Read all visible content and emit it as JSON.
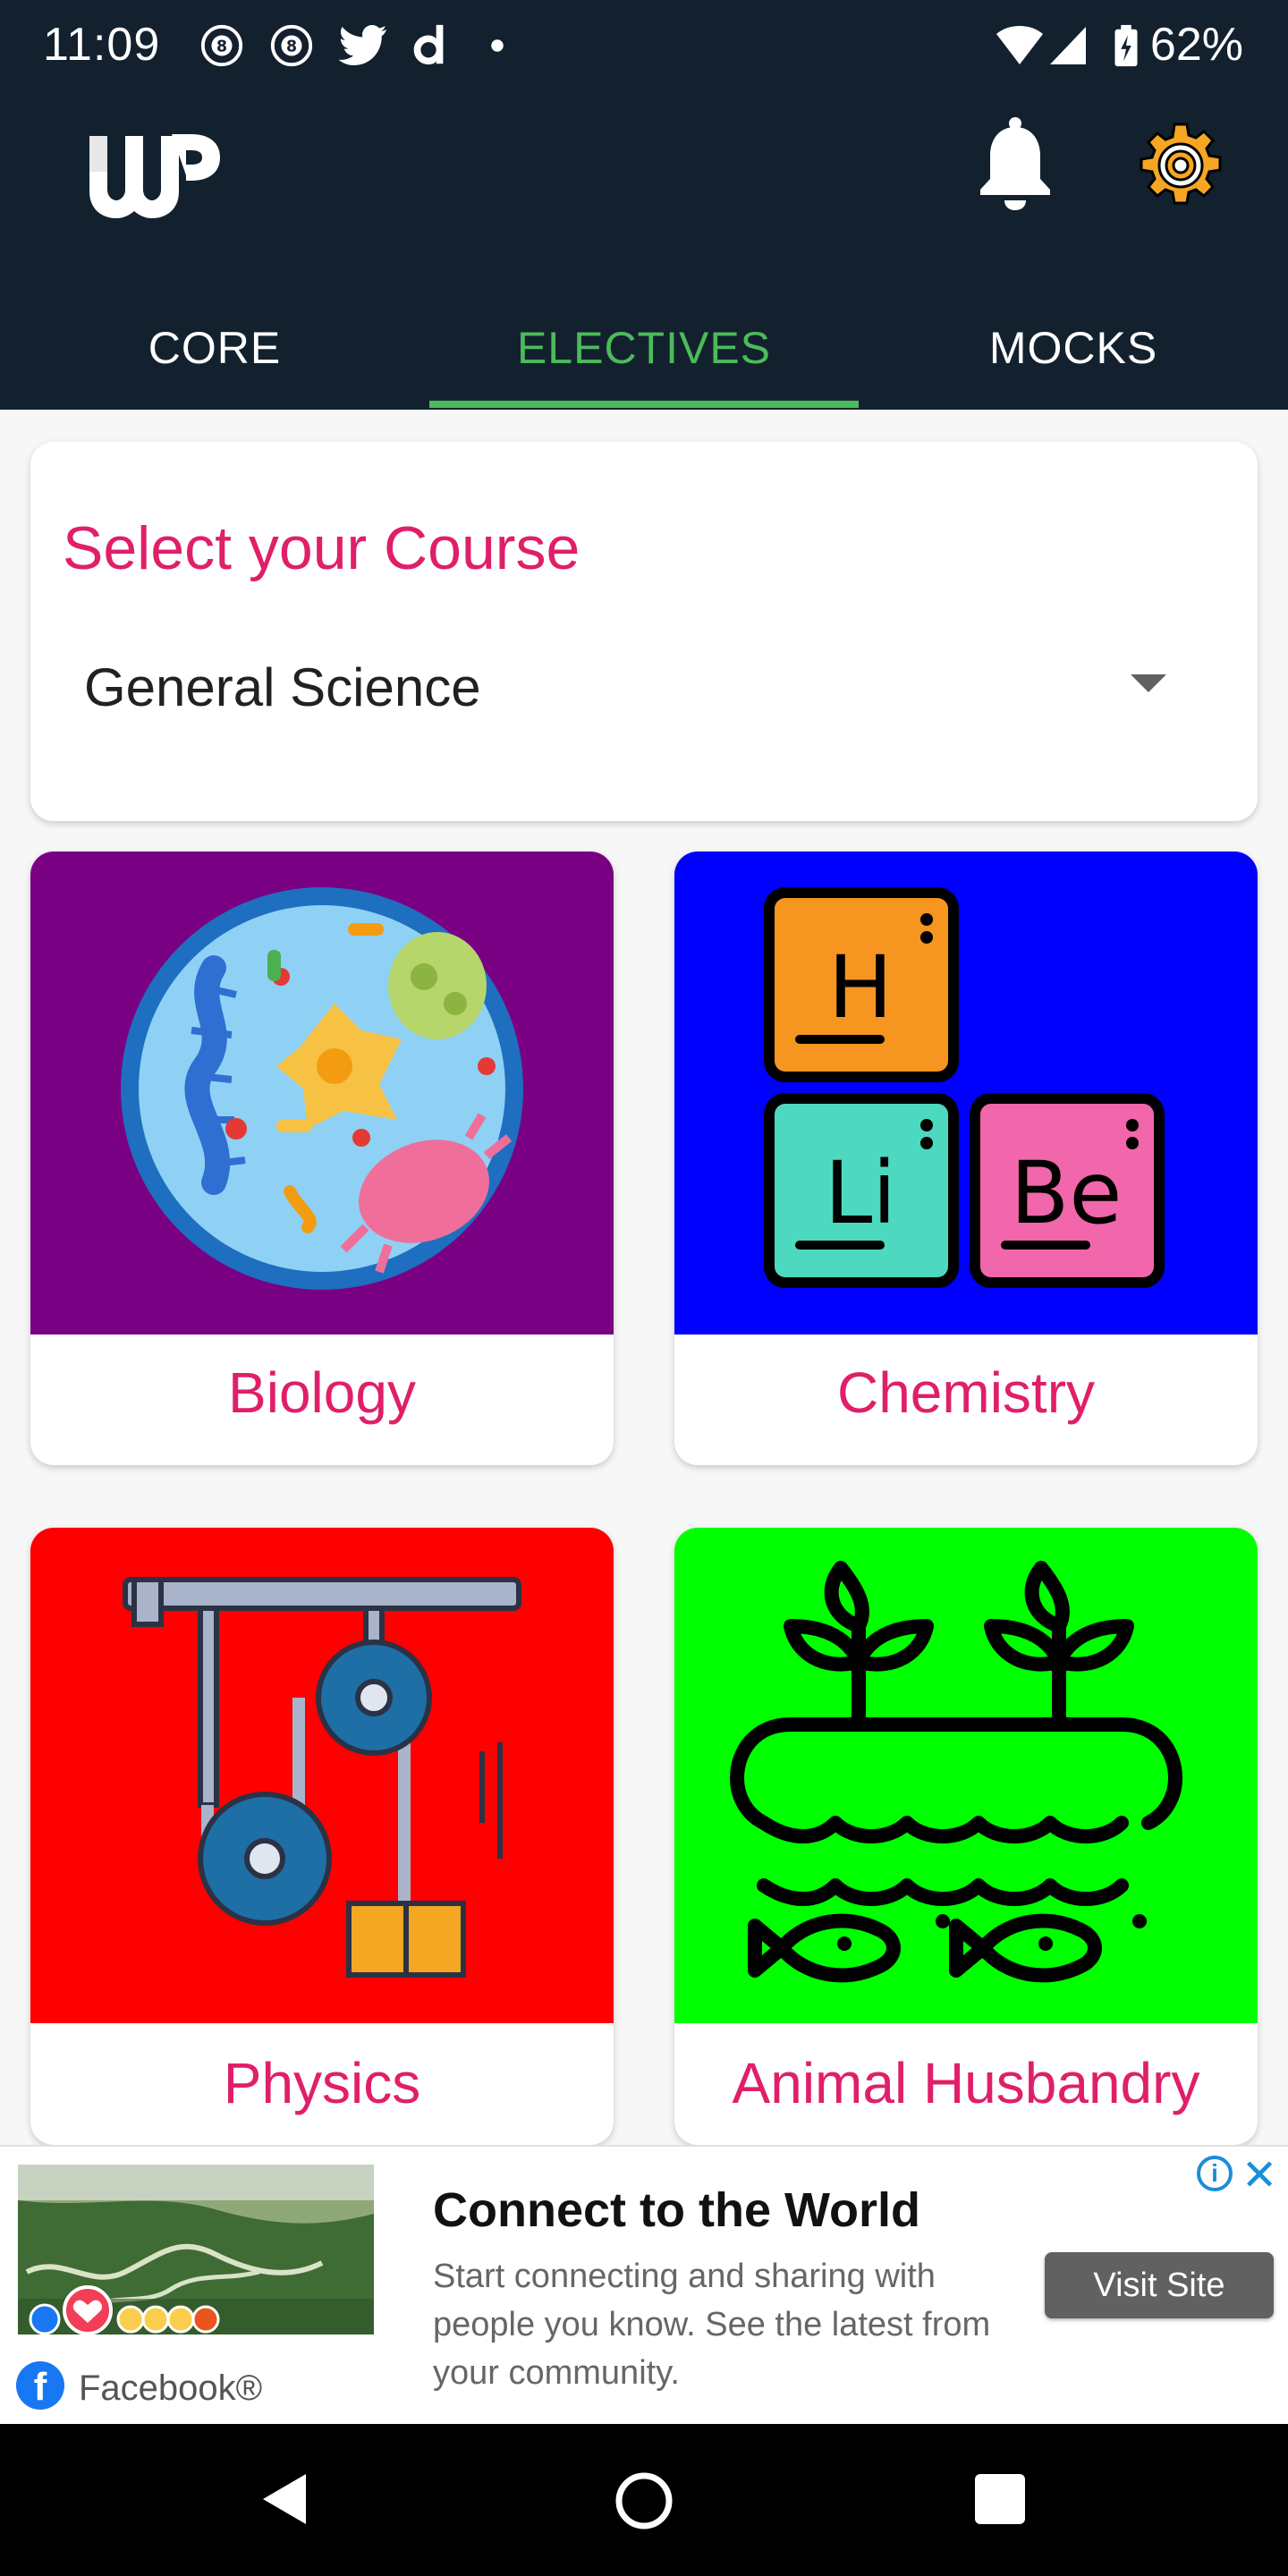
{
  "status_bar": {
    "time": "11:09",
    "battery": "62%",
    "icons": [
      "8ball-icon",
      "8ball-icon",
      "twitter-icon",
      "dailymotion-icon",
      "dot-icon",
      "wifi-icon",
      "signal-icon",
      "battery-icon"
    ]
  },
  "app_bar": {
    "logo_icon": "wp-logo-icon",
    "notification_icon": "bell-icon",
    "settings_icon": "gear-icon"
  },
  "tabs": [
    {
      "label": "CORE",
      "active": false
    },
    {
      "label": "ELECTIVES",
      "active": true
    },
    {
      "label": "MOCKS",
      "active": false
    }
  ],
  "course_card": {
    "title": "Select your Course",
    "selected_course": "General Science"
  },
  "subjects": [
    {
      "label": "Biology",
      "bg_color": "#7a0083",
      "icon": "cell-icon"
    },
    {
      "label": "Chemistry",
      "bg_color": "#0000ff",
      "icon": "periodic-table-icon"
    },
    {
      "label": "Physics",
      "bg_color": "#ff0000",
      "icon": "pulley-icon"
    },
    {
      "label": "Animal Husbandry",
      "bg_color": "#00ff00",
      "icon": "plants-fish-icon"
    }
  ],
  "ad": {
    "title": "Connect to the World",
    "description": "Start connecting and sharing with people you know. See the latest from your community.",
    "button": "Visit Site",
    "source": "Facebook®"
  },
  "colors": {
    "header_bg": "#13212e",
    "accent": "#4cbb5a",
    "primary": "#e01f69"
  }
}
